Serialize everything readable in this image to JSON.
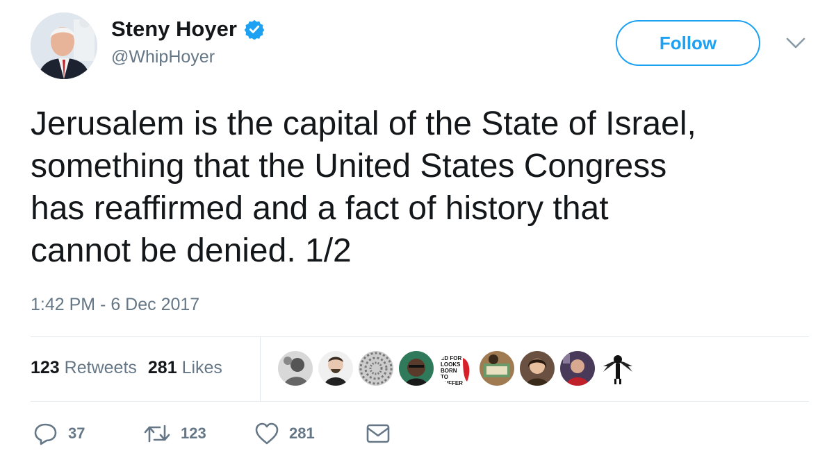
{
  "author": {
    "display_name": "Steny Hoyer",
    "handle": "@WhipHoyer",
    "verified_icon": "verified-badge-icon"
  },
  "header": {
    "follow_label": "Follow",
    "menu_icon": "chevron-down-icon"
  },
  "tweet": {
    "lines": [
      "Jerusalem is the capital of the State of Israel,",
      "something that the United States Congress",
      "has reaffirmed and a fact of history that",
      "cannot be denied. 1/2"
    ],
    "timestamp": "1:42 PM - 6 Dec 2017"
  },
  "stats": {
    "retweets_count": "123",
    "retweets_label": "Retweets",
    "likes_count": "281",
    "likes_label": "Likes"
  },
  "liker_avatars": [
    {
      "label": ""
    },
    {
      "label": ""
    },
    {
      "label": ""
    },
    {
      "label": ""
    },
    {
      "label": "ED FOR LOOKS BORN TO SUFFER"
    },
    {
      "label": ""
    },
    {
      "label": ""
    },
    {
      "label": ""
    },
    {
      "label": ""
    }
  ],
  "actions": {
    "reply_count": "37",
    "retweet_count": "123",
    "like_count": "281"
  },
  "colors": {
    "accent": "#1da1f2",
    "muted": "#657786",
    "text": "#14171a",
    "divider": "#e1e8ed"
  }
}
